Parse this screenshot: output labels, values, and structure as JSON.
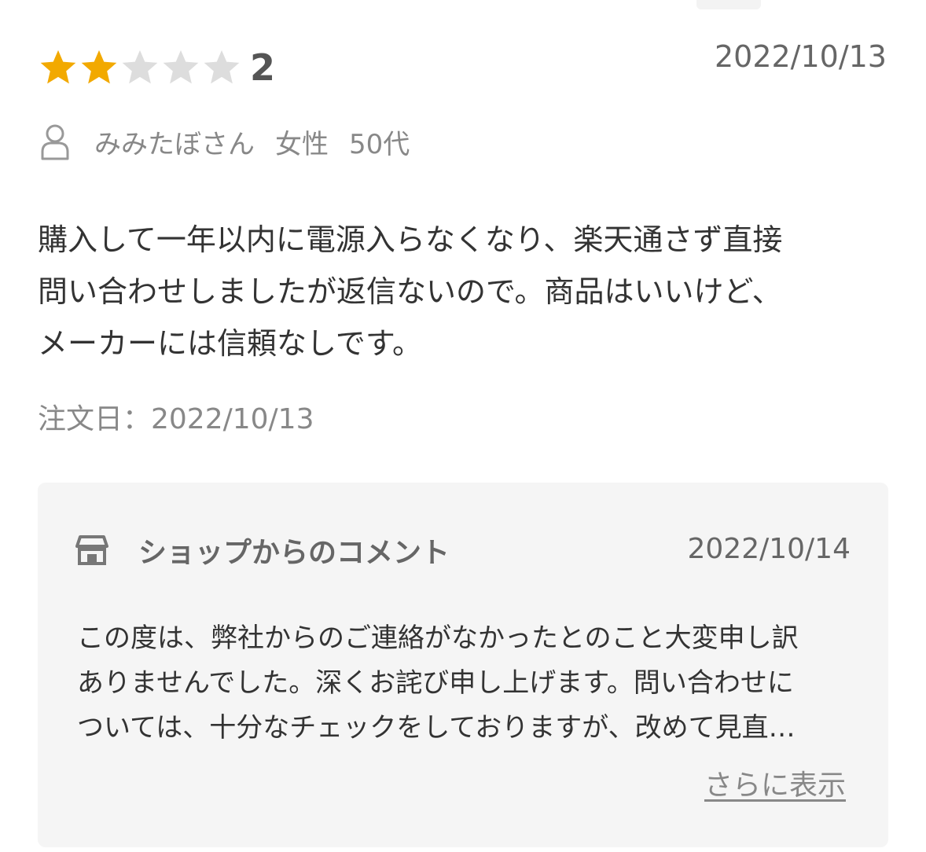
{
  "review": {
    "rating_value": 2,
    "rating_max": 5,
    "rating_label": "2",
    "date": "2022/10/13",
    "reviewer": {
      "name": "みみたぼさん",
      "gender": "女性",
      "age": "50代"
    },
    "body_lines": [
      "購入して一年以内に電源入らなくなり、楽天通さず直接",
      "問い合わせしましたが返信ないので。商品はいいけど、",
      "メーカーには信頼なしです。"
    ],
    "order_date": "注文日：2022/10/13"
  },
  "shop_comment": {
    "title": "ショップからのコメント",
    "date": "2022/10/14",
    "body_lines": [
      "この度は、弊社からのご連絡がなかったとのこと大変申し訳",
      "ありませんでした。深くお詫び申し上げます。問い合わせに",
      "ついては、十分なチェックをしておりますが、改めて見直…"
    ],
    "show_more_label": "さらに表示"
  },
  "colors": {
    "star_filled": "#F2A900",
    "star_empty": "#DDDDDD",
    "comment_bg": "#F5F5F5",
    "muted_text": "#888888"
  },
  "icons": {
    "reviewer": "user-icon",
    "shop": "shop-icon",
    "star": "star-icon"
  }
}
